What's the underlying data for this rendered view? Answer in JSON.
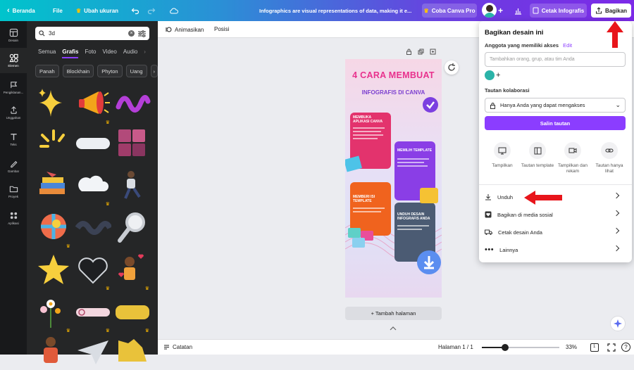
{
  "topbar": {
    "back_label": "Beranda",
    "file_label": "File",
    "resize_label": "Ubah ukuran",
    "doc_title": "Infographics are visual representations of data, making it e...",
    "pro_label": "Coba Canva Pro",
    "print_label": "Cetak Infografis",
    "share_label": "Bagikan"
  },
  "rail": {
    "items": [
      {
        "label": "Desain",
        "icon": "layout-icon"
      },
      {
        "label": "Elemen",
        "icon": "shapes-icon"
      },
      {
        "label": "Pengiklanan...",
        "icon": "brand-icon"
      },
      {
        "label": "Unggahan",
        "icon": "upload-icon"
      },
      {
        "label": "Teks",
        "icon": "text-icon"
      },
      {
        "label": "Gambar",
        "icon": "draw-icon"
      },
      {
        "label": "Proyek",
        "icon": "folder-icon"
      },
      {
        "label": "Aplikasi",
        "icon": "apps-icon"
      }
    ]
  },
  "panel": {
    "search_value": "3d",
    "categories": [
      "Semua",
      "Grafis",
      "Foto",
      "Video",
      "Audio"
    ],
    "chips": [
      "Panah",
      "Blockhain",
      "Phyton",
      "Uang"
    ]
  },
  "subbar": {
    "animate_label": "Animasikan",
    "position_label": "Posisi"
  },
  "canvas": {
    "add_page_label": "+ Tambah halaman",
    "infographic": {
      "title_line1": "4 CARA MEMBUAT",
      "title_line2": "INFOGRAFIS DI CANVA",
      "step1": "MEMBUKA APLIKASI CANVA",
      "step2": "MEMILIH TEMPLATE",
      "step3": "MEMBERI ISI TEMPLATE",
      "step4": "UNDUH DESAIN INFOGRAFIS ANDA"
    }
  },
  "bottombar": {
    "notes_label": "Catatan",
    "page_label": "Halaman 1 / 1",
    "zoom_label": "33%",
    "zoom_fraction": 0.3,
    "help_label": "?"
  },
  "share_menu": {
    "title": "Bagikan desain ini",
    "access_label": "Anggota yang memiliki akses",
    "edit_label": "Edit",
    "invite_placeholder": "Tambahkan orang, grup, atau tim Anda",
    "collab_label": "Tautan kolaborasi",
    "access_select": "Hanya Anda yang dapat mengakses",
    "copy_link_label": "Salin tautan",
    "quick_actions": [
      {
        "label": "Tampilkan",
        "icon": "present-icon"
      },
      {
        "label": "Tautan template",
        "icon": "template-icon"
      },
      {
        "label": "Tampilkan dan rekam",
        "icon": "record-icon"
      },
      {
        "label": "Tautan hanya lihat",
        "icon": "link-icon"
      }
    ],
    "menu_items": [
      {
        "label": "Unduh",
        "icon": "download-icon"
      },
      {
        "label": "Bagikan di media sosial",
        "icon": "heart-icon"
      },
      {
        "label": "Cetak desain Anda",
        "icon": "truck-icon"
      },
      {
        "label": "Lainnya",
        "icon": "more-icon"
      }
    ]
  },
  "colors": {
    "accent": "#8b3dff",
    "annotation_arrow": "#e8151b"
  }
}
